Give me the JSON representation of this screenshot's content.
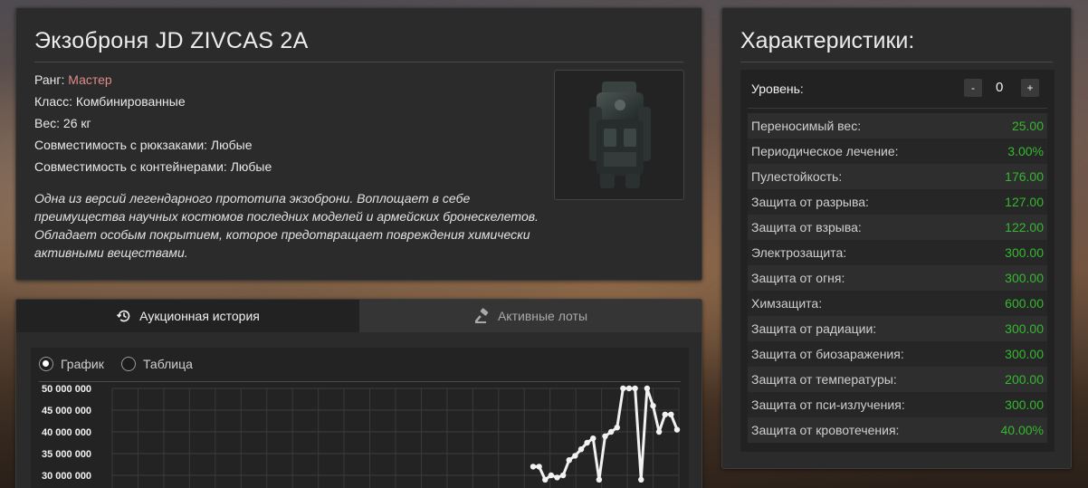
{
  "item": {
    "title": "Экзоброня JD ZIVCAS 2A",
    "rank_label": "Ранг:",
    "rank_value": "Мастер",
    "class_text": "Класс: Комбинированные",
    "weight_text": "Вес: 26 кг",
    "backpack_text": "Совместимость с рюкзаками: Любые",
    "container_text": "Совместимость с контейнерами: Любые",
    "description": "Одна из версий легендарного прототипа экзоброни. Воплощает в себе преимущества научных костюмов последних моделей и армейских бронескелетов. Обладает особым покрытием, которое предотвращает повреждения химически активными веществами.",
    "rank_color": "#e08a8a"
  },
  "auction": {
    "tabs": [
      {
        "label": "Аукционная история",
        "icon": "history-icon",
        "active": true
      },
      {
        "label": "Активные лоты",
        "icon": "gavel-icon",
        "active": false
      }
    ],
    "view_options": [
      {
        "label": "График",
        "checked": true
      },
      {
        "label": "Таблица",
        "checked": false
      }
    ]
  },
  "chart_data": {
    "type": "line",
    "y_ticks": [
      "50 000 000",
      "45 000 000",
      "40 000 000",
      "35 000 000",
      "30 000 000"
    ],
    "ylim": [
      25000000,
      50000000
    ],
    "grid": true,
    "series": [
      {
        "points": [
          32000000,
          32000000,
          29000000,
          30000000,
          29500000,
          30000000,
          33500000,
          34500000,
          36000000,
          37500000,
          38500000,
          29000000,
          39000000,
          40000000,
          41000000,
          50000000,
          50000000,
          50000000,
          29000000,
          50000000,
          46000000,
          40000000,
          44000000,
          44000000,
          40500000
        ],
        "color": "#f2f2f2"
      }
    ]
  },
  "stats": {
    "title": "Характеристики:",
    "level_label": "Уровень:",
    "level_minus": "-",
    "level_value": "0",
    "level_plus": "+",
    "value_color": "#35b82f",
    "rows": [
      {
        "name": "Переносимый вес:",
        "value": "25.00"
      },
      {
        "name": "Периодическое лечение:",
        "value": "3.00%"
      },
      {
        "name": "Пулестойкость:",
        "value": "176.00"
      },
      {
        "name": "Защита от разрыва:",
        "value": "127.00"
      },
      {
        "name": "Защита от взрыва:",
        "value": "122.00"
      },
      {
        "name": "Электрозащита:",
        "value": "300.00"
      },
      {
        "name": "Защита от огня:",
        "value": "300.00"
      },
      {
        "name": "Химзащита:",
        "value": "600.00"
      },
      {
        "name": "Защита от радиации:",
        "value": "300.00"
      },
      {
        "name": "Защита от биозаражения:",
        "value": "300.00"
      },
      {
        "name": "Защита от температуры:",
        "value": "200.00"
      },
      {
        "name": "Защита от пси-излучения:",
        "value": "300.00"
      },
      {
        "name": "Защита от кровотечения:",
        "value": "40.00%"
      }
    ]
  }
}
